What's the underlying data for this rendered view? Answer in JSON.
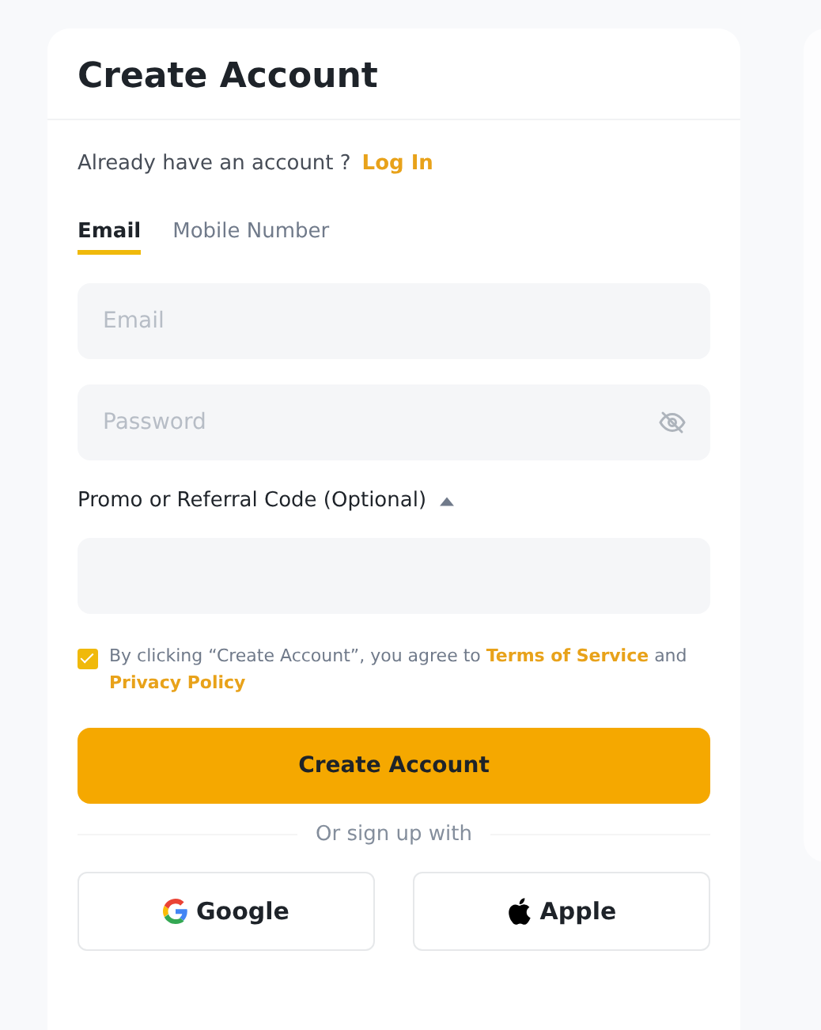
{
  "title": "Create Account",
  "login_prompt": {
    "text": "Already have an account ?",
    "link": "Log In"
  },
  "tabs": [
    {
      "label": "Email",
      "selected": true
    },
    {
      "label": "Mobile Number",
      "selected": false
    }
  ],
  "fields": [
    {
      "placeholder": "Email",
      "kind": "text"
    },
    {
      "placeholder": "Password",
      "kind": "password"
    }
  ],
  "promo": {
    "label": "Promo or Referral Code (Optional)",
    "expanded": true
  },
  "agreement": {
    "checked": true,
    "text": "By clicking “Create Account”, you agree to",
    "terms_link": "Terms of Service",
    "joiner": "and",
    "privacy_link": "Privacy Policy"
  },
  "submit": "Create Account",
  "divider": "Or sign up with",
  "social_buttons": [
    {
      "label": "Google",
      "kind": "google"
    },
    {
      "label": "Apple",
      "kind": "apple"
    }
  ]
}
